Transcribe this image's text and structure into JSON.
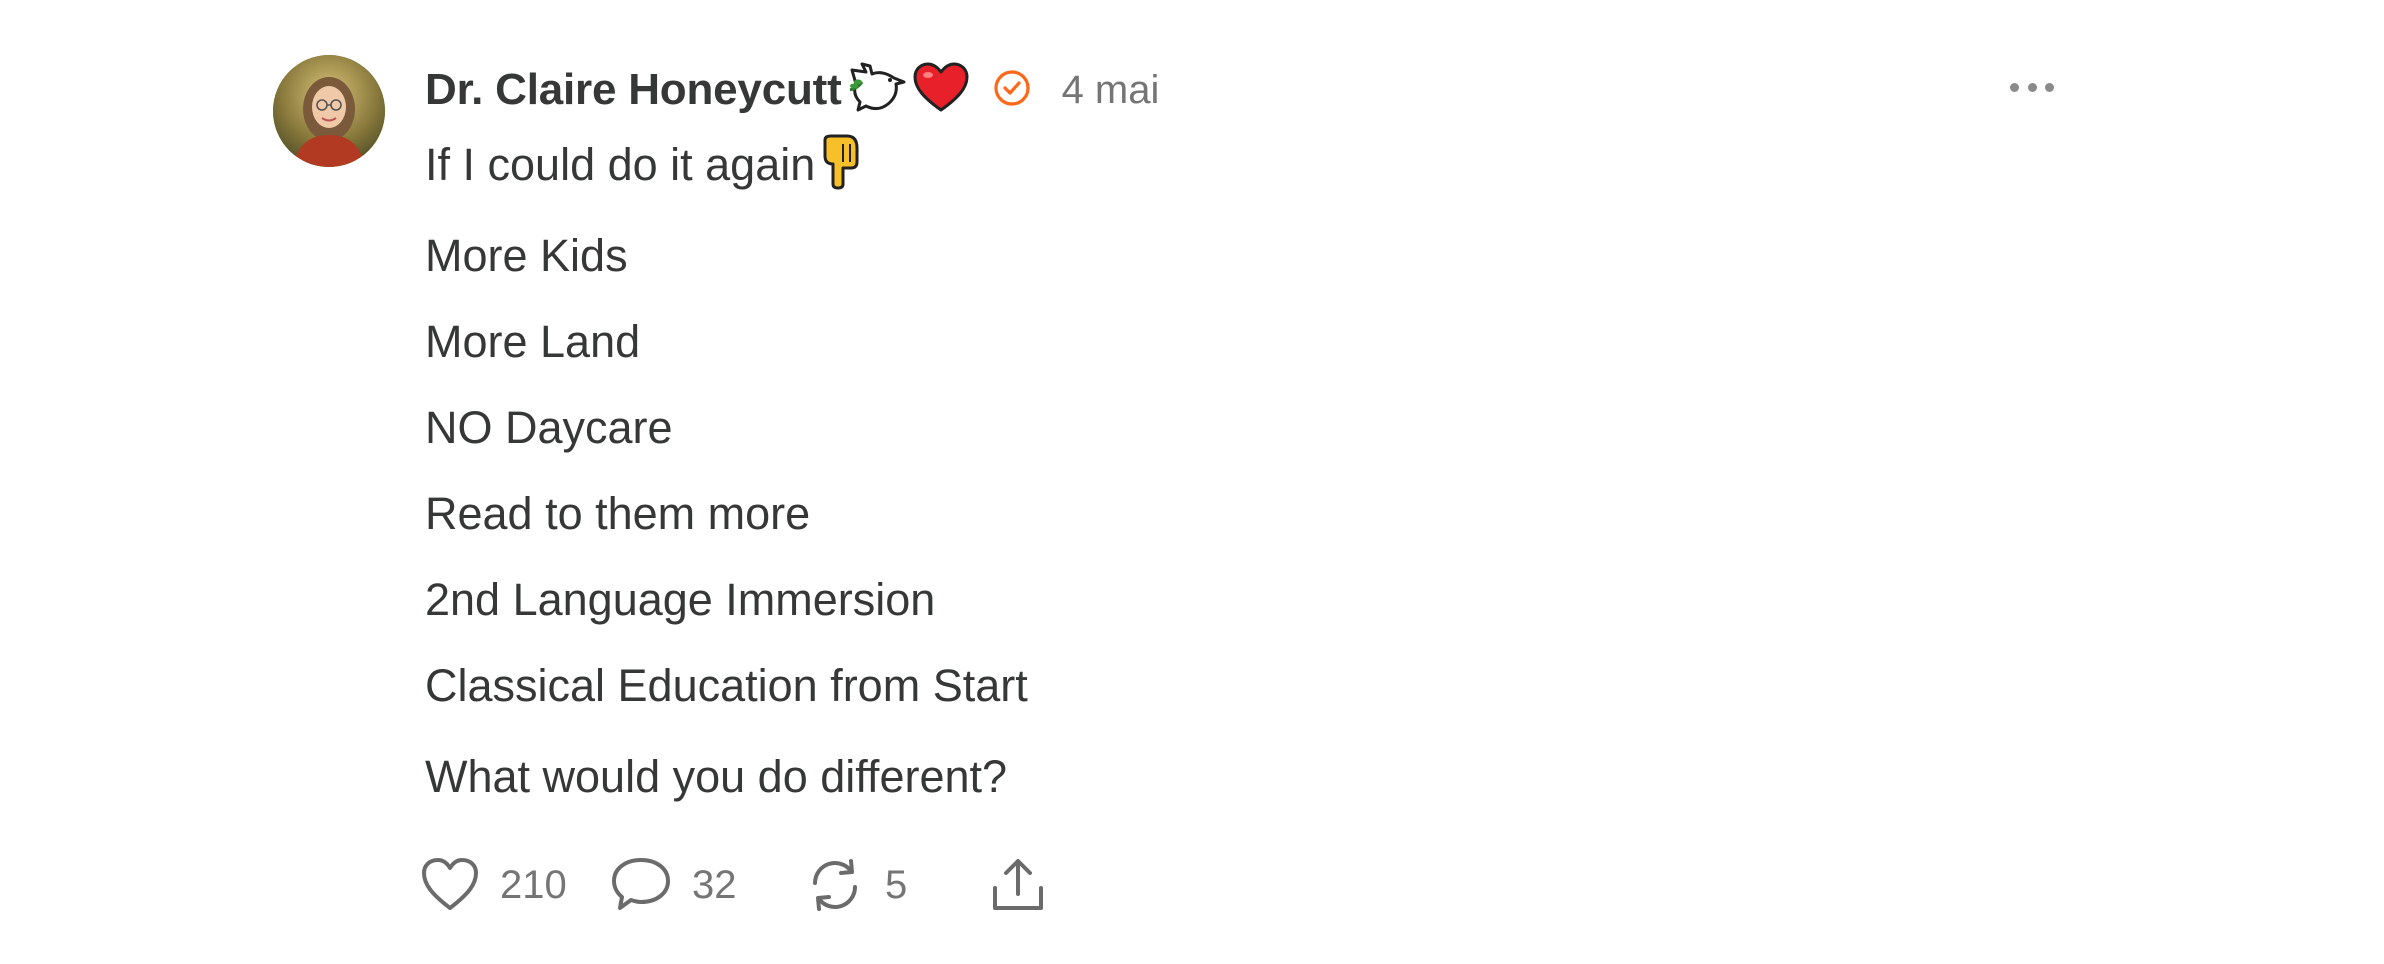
{
  "post": {
    "author": "Dr. Claire Honeycutt",
    "author_emojis": [
      "dove-icon",
      "heart-icon"
    ],
    "verified_icon": "check-circle-icon",
    "date": "4 mai",
    "more_icon": "ellipsis-icon",
    "intro": "If I could do it again",
    "intro_emoji": "pointing-down-icon",
    "lines": [
      "More Kids",
      "More Land",
      "NO Daycare",
      "Read to them more",
      "2nd Language Immersion",
      "Classical Education from Start"
    ],
    "question": "What would you do different?"
  },
  "actions": {
    "likes": "210",
    "comments": "32",
    "restacks": "5"
  },
  "colors": {
    "text": "#363737",
    "muted": "#757575",
    "accent": "#FF6719",
    "heart": "#E8202A"
  }
}
